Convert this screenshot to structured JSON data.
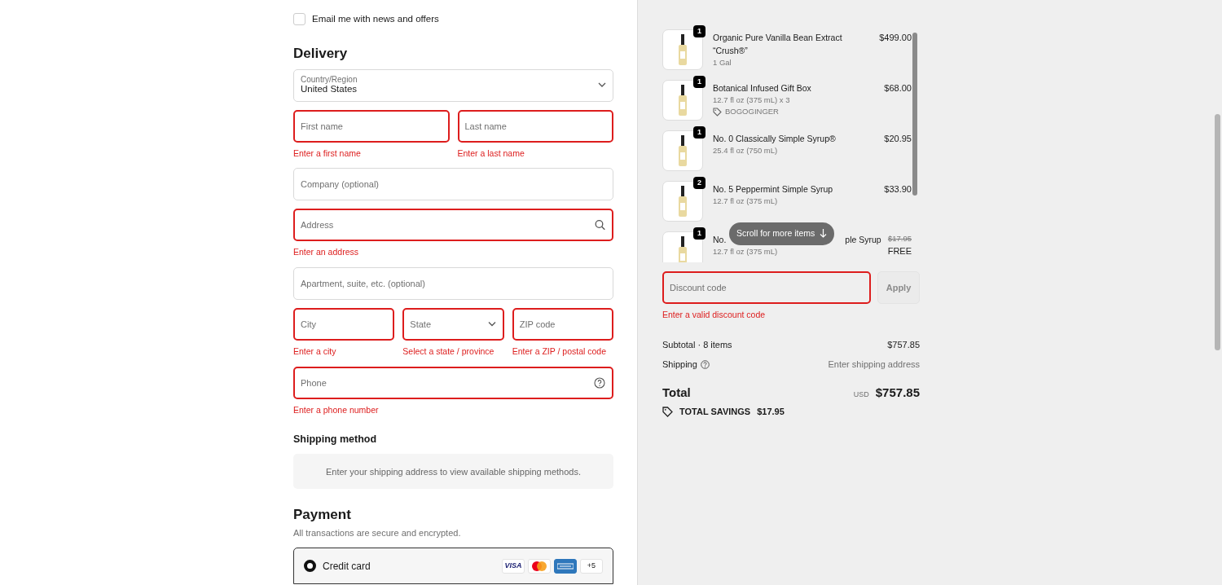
{
  "marketing": {
    "label": "Email me with news and offers",
    "checked": false
  },
  "delivery": {
    "title": "Delivery",
    "rows": [
      [
        {
          "kind": "select",
          "label": "Country/Region",
          "value": "United States",
          "invalid": false
        }
      ],
      [
        {
          "kind": "text",
          "placeholder": "First name",
          "invalid": true,
          "error": "Enter a first name"
        },
        {
          "kind": "text",
          "placeholder": "Last name",
          "invalid": true,
          "error": "Enter a last name"
        }
      ],
      [
        {
          "kind": "text",
          "placeholder": "Company (optional)",
          "invalid": false
        }
      ],
      [
        {
          "kind": "search",
          "placeholder": "Address",
          "invalid": true,
          "error": "Enter an address"
        }
      ],
      [
        {
          "kind": "text",
          "placeholder": "Apartment, suite, etc. (optional)",
          "invalid": false
        }
      ],
      [
        {
          "kind": "text",
          "placeholder": "City",
          "invalid": true,
          "error": "Enter a city"
        },
        {
          "kind": "dropdown",
          "placeholder": "State",
          "invalid": true,
          "error": "Select a state / province"
        },
        {
          "kind": "text",
          "placeholder": "ZIP code",
          "invalid": true,
          "error": "Enter a ZIP / postal code"
        }
      ],
      [
        {
          "kind": "help",
          "placeholder": "Phone",
          "invalid": true,
          "error": "Enter a phone number"
        }
      ]
    ]
  },
  "shipping_method": {
    "title": "Shipping method",
    "message": "Enter your shipping address to view available shipping methods."
  },
  "payment": {
    "title": "Payment",
    "subtitle": "All transactions are secure and encrypted.",
    "methods": [
      {
        "label": "Credit card",
        "selected": true,
        "brands": [
          {
            "kind": "visa",
            "text": "VISA"
          },
          {
            "kind": "mastercard"
          },
          {
            "kind": "amex"
          },
          {
            "kind": "more",
            "text": "+5"
          }
        ]
      }
    ]
  },
  "cart": {
    "scroll_hint": "Scroll for more items",
    "items": [
      {
        "quantity": "1",
        "name_parts": [
          "Organic Pure Vanilla Bean Extract “Crush®”"
        ],
        "variant": "1 Gal",
        "price": "$499.00"
      },
      {
        "quantity": "1",
        "name_parts": [
          "Botanical Infused Gift Box"
        ],
        "variant": "12.7 fl oz (375 mL) x 3",
        "discount_tag": "BOGOGINGER",
        "price": "$68.00"
      },
      {
        "quantity": "1",
        "name_parts": [
          "No. 0 Classically Simple Syrup®"
        ],
        "variant": "25.4 fl oz (750 mL)",
        "price": "$20.95"
      },
      {
        "quantity": "2",
        "name_parts": [
          "No. 5 Peppermint Simple Syrup"
        ],
        "variant": "12.7 fl oz (375 mL)",
        "price": "$33.90"
      },
      {
        "quantity": "1",
        "name_parts": [
          "No.",
          "ple Syrup"
        ],
        "variant": "12.7 fl oz (375 mL)",
        "original_price": "$17.95",
        "price": "FREE"
      }
    ]
  },
  "discount": {
    "placeholder": "Discount code",
    "invalid": true,
    "error": "Enter a valid discount code",
    "button": "Apply",
    "button_disabled": true
  },
  "summary": {
    "subtotal_label": "Subtotal · 8 items",
    "subtotal": "$757.85",
    "shipping_label": "Shipping",
    "shipping": "Enter shipping address",
    "total_label": "Total",
    "currency": "USD",
    "total": "$757.85",
    "savings_label": "TOTAL SAVINGS",
    "savings": "$17.95"
  }
}
